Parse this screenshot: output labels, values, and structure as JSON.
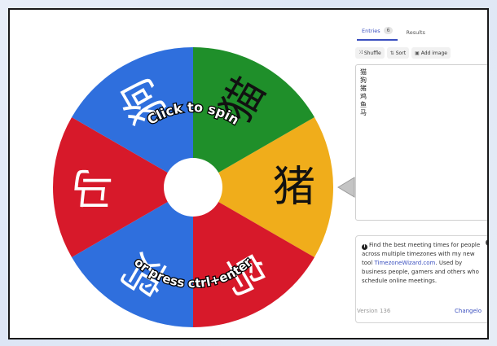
{
  "wheel": {
    "segments": [
      {
        "label": "猪",
        "color": "#f0ad1b",
        "text_color": "#111111"
      },
      {
        "label": "鸟",
        "color": "#d7192a",
        "text_color": "#ffffff"
      },
      {
        "label": "鸡",
        "color": "#2f6fdd",
        "text_color": "#ffffff"
      },
      {
        "label": "马",
        "color": "#d7192a",
        "text_color": "#ffffff"
      },
      {
        "label": "狗",
        "color": "#2f6fdd",
        "text_color": "#ffffff"
      },
      {
        "label": "猫",
        "color": "#1f8f2a",
        "text_color": "#111111"
      }
    ],
    "spin_text": "Click to spin",
    "ctrl_text": "or press ctrl+enter",
    "pointer_color": "#c4c4c4"
  },
  "panel": {
    "tabs": [
      {
        "label": "Entries",
        "badge": "6",
        "active": true
      },
      {
        "label": "Results",
        "badge": "",
        "active": false
      }
    ],
    "toolbar": {
      "shuffle_label": "Shuffle",
      "sort_label": "Sort",
      "add_image_label": "Add image"
    },
    "entries": [
      "猫",
      "狗",
      "猪",
      "鸡",
      "鱼",
      "马"
    ],
    "info": {
      "line1": "Find the best meeting times for people across multiple timezones with my new tool ",
      "link": "TimezoneWizard.com",
      "line2": ". Used by business people, gamers and others who schedule online meetings."
    },
    "version": "Version 136",
    "changelog": "Changelo"
  }
}
